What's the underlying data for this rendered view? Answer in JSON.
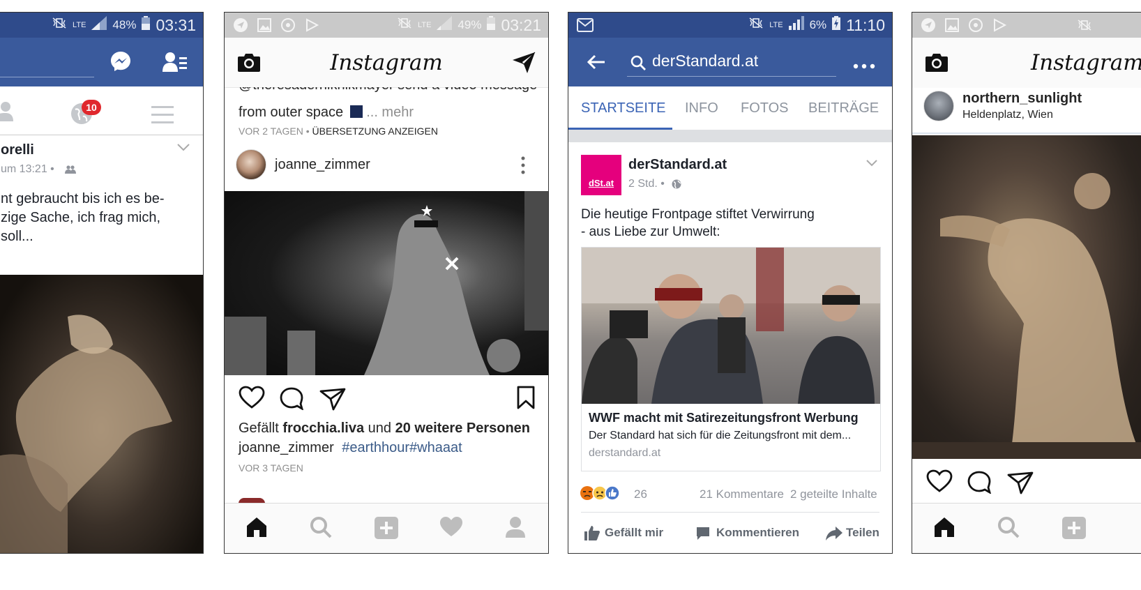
{
  "panel1": {
    "status": {
      "lte": "LTE",
      "battery": "48%",
      "time": "03:31"
    },
    "badge_count": "10",
    "post": {
      "author": "orelli",
      "time": "um 13:21 •",
      "lines": [
        "nt gebraucht bis ich es be-",
        "zige Sache, ich frag mich,",
        " soll..."
      ]
    }
  },
  "panel2": {
    "status": {
      "lte": "LTE",
      "battery": "49%",
      "time": "03:21"
    },
    "app_title": "Instagram",
    "prev_post": {
      "partial_line": "@theresaderniknikmayer send a video message",
      "caption_line": "from outer space",
      "more": "... mehr",
      "age": "VOR 2 TAGEN •",
      "translate": "ÜBERSETZUNG ANZEIGEN"
    },
    "post": {
      "username": "joanne_zimmer",
      "likes_prefix": "Gefällt",
      "likes_user": "frocchia.liva",
      "likes_and": "und",
      "likes_rest": "20 weitere Personen",
      "caption_user": "joanne_zimmer",
      "hashtags": "#earthhour#whaaat",
      "age": "VOR 3 TAGEN"
    }
  },
  "panel3": {
    "status": {
      "lte": "LTE",
      "battery": "6%",
      "time": "11:10"
    },
    "search_value": "derStandard.at",
    "tabs": [
      "STARTSEITE",
      "INFO",
      "FOTOS",
      "BEITRÄGE"
    ],
    "active_tab": "STARTSEITE",
    "page_logo_text": "dSt.at",
    "post": {
      "page_name": "derStandard.at",
      "meta": "2 Std. •",
      "text_line1": "Die heutige Frontpage stiftet Verwirrung",
      "text_line2": "- aus Liebe zur Umwelt:",
      "link_title": "WWF macht mit Satirezeitungsfront Werbung",
      "link_desc": "Der Standard hat sich für die Zeitungsfront mit dem...",
      "link_domain": "derstandard.at",
      "reactions_count": "26",
      "comments": "21 Kommentare",
      "shares": "2 geteilte Inhalte",
      "actions": {
        "like": "Gefällt mir",
        "comment": "Kommentieren",
        "share": "Teilen"
      }
    }
  },
  "panel4": {
    "app_title": "Instagram",
    "username": "northern_sunlight",
    "location": "Heldenplatz, Wien"
  },
  "colors": {
    "fb_blue": "#3a5a9c",
    "fb_status": "#2f4b8b",
    "badge_red": "#e0282d",
    "tab_active": "#3b64b5",
    "logo_pink": "#e5007d",
    "hashtag": "#3b5b88"
  }
}
